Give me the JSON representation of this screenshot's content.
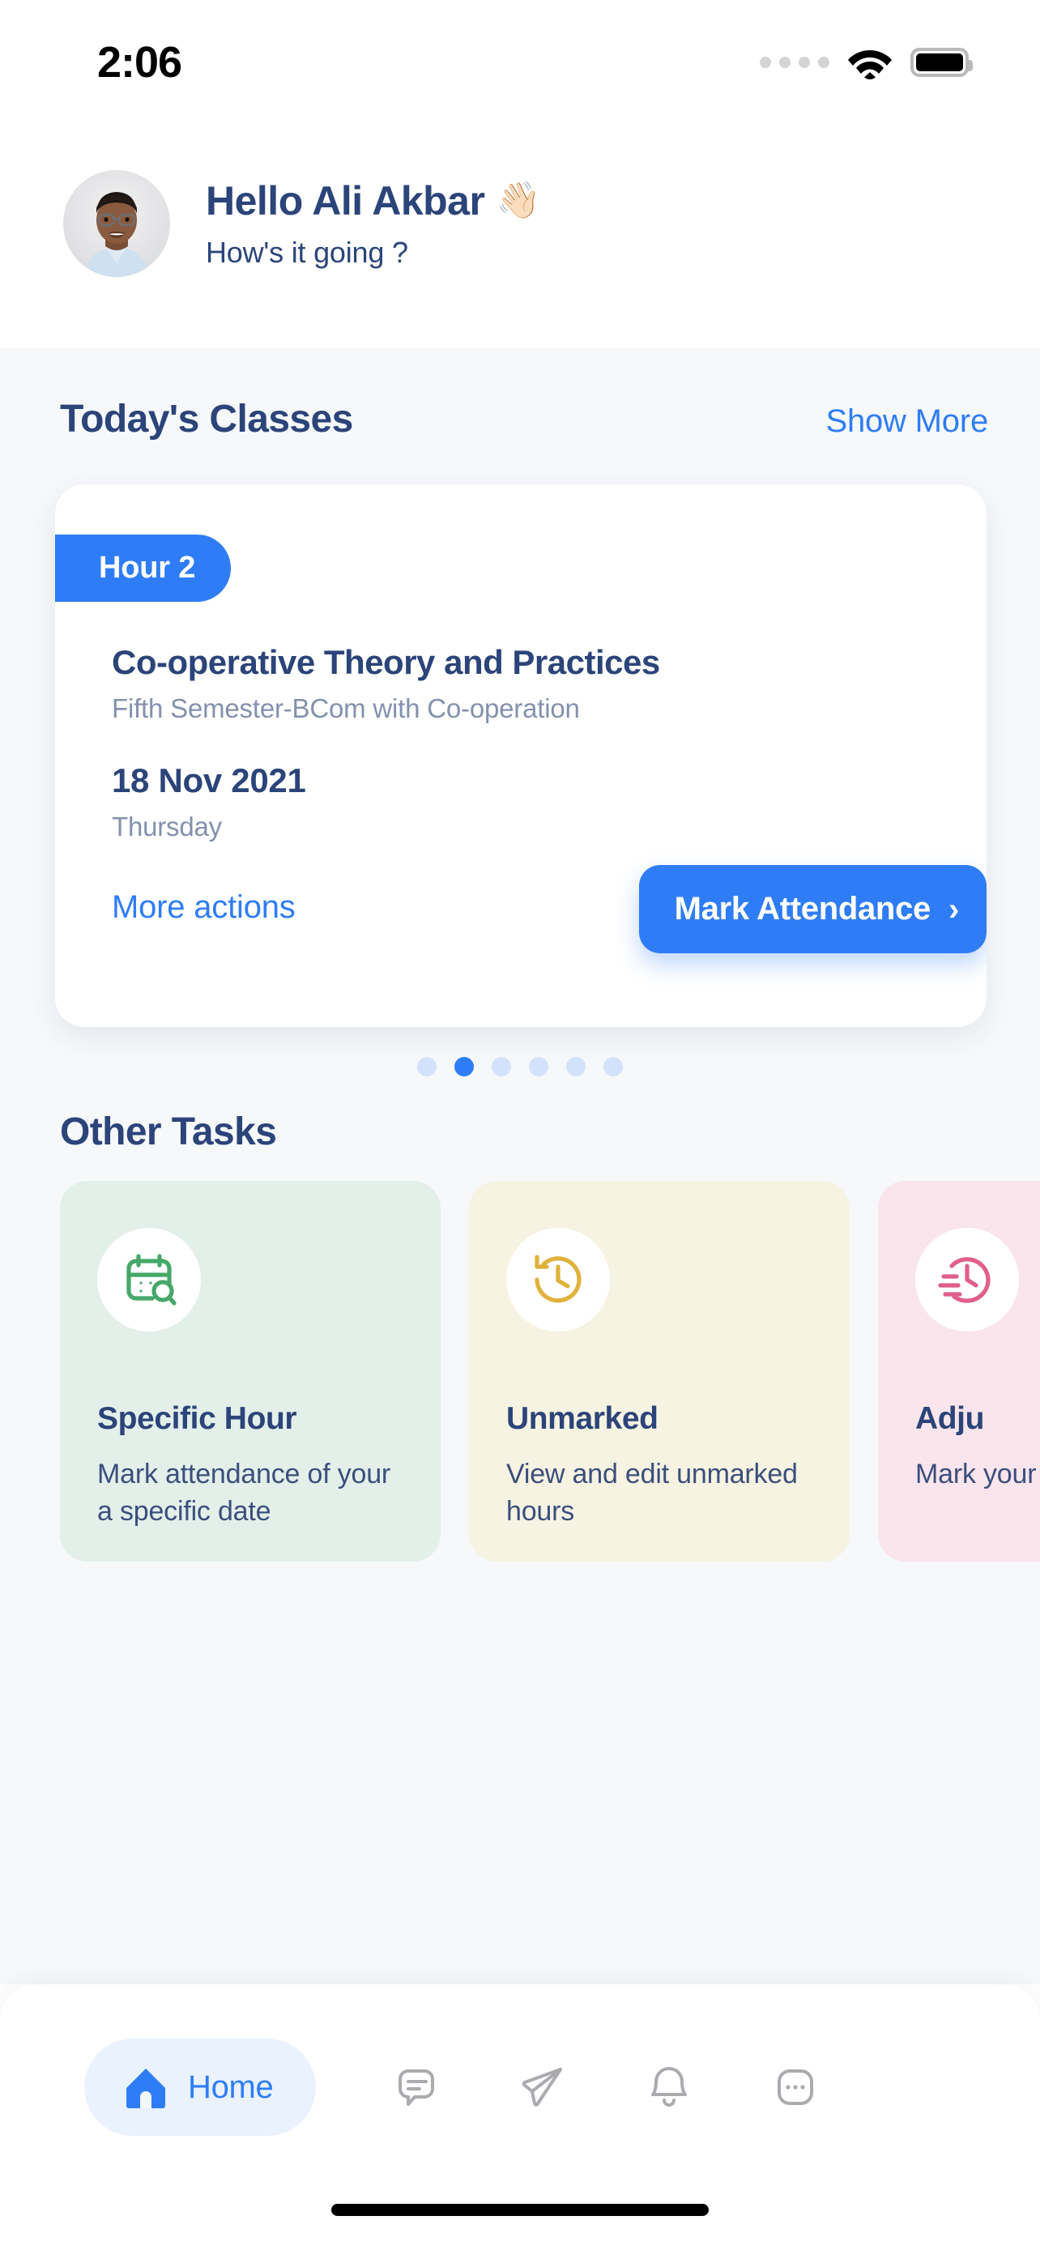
{
  "status_bar": {
    "time": "2:06",
    "signal_icon": "signal-dots-icon",
    "wifi_icon": "wifi-icon",
    "battery_icon": "battery-full-icon"
  },
  "header": {
    "avatar_icon": "user-avatar-photo",
    "greeting": "Hello Ali Akbar",
    "wave_icon": "👋🏻",
    "subtitle": "How's it going ?"
  },
  "today_classes": {
    "section_title": "Today's Classes",
    "show_more": "Show More",
    "card": {
      "hour_badge": "Hour 2",
      "course_title": "Co-operative Theory and Practices",
      "course_subtitle": "Fifth Semester-BCom with Co-operation",
      "date": "18 Nov 2021",
      "weekday": "Thursday",
      "more_actions": "More actions",
      "primary_action": "Mark Attendance",
      "chevron_icon": "›"
    },
    "pagination": {
      "total": 6,
      "active_index": 1
    }
  },
  "other_tasks": {
    "section_title": "Other Tasks",
    "cards": [
      {
        "icon": "calendar-search-icon",
        "title": "Specific Hour",
        "description": "Mark attendance of your a specific date",
        "bg": "#e3efe9",
        "accent": "#46a868"
      },
      {
        "icon": "clock-rewind-icon",
        "title": "Unmarked",
        "description": "View and edit unmarked hours",
        "bg": "#f7f3e2",
        "accent": "#e0b23c"
      },
      {
        "icon": "clock-speed-icon",
        "title": "Adju",
        "description": "Mark your a",
        "bg": "#fae5ec",
        "accent": "#e05f88"
      }
    ]
  },
  "bottom_nav": {
    "items": [
      {
        "icon": "home-icon",
        "label": "Home",
        "active": true
      },
      {
        "icon": "chat-bubble-icon",
        "label": "",
        "active": false
      },
      {
        "icon": "send-icon",
        "label": "",
        "active": false
      },
      {
        "icon": "bell-icon",
        "label": "",
        "active": false
      },
      {
        "icon": "more-dots-icon",
        "label": "",
        "active": false
      }
    ]
  },
  "colors": {
    "accent_blue": "#2f7df6",
    "navy_text": "#2b4479",
    "muted_text": "#8490ad",
    "page_bg": "#f6f8fa"
  }
}
